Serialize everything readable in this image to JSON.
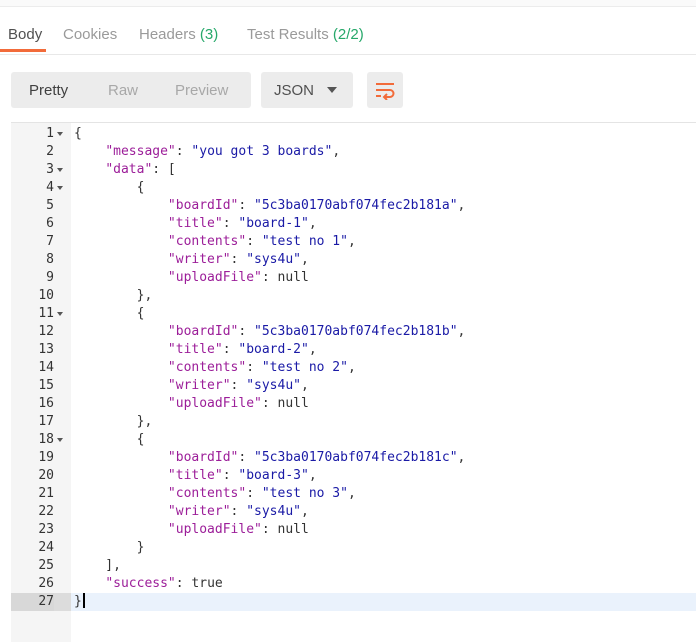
{
  "tabs": [
    {
      "label": "Body",
      "count": ""
    },
    {
      "label": "Cookies",
      "count": ""
    },
    {
      "label": "Headers",
      "count": "(3)"
    },
    {
      "label": "Test Results",
      "count": "(2/2)"
    }
  ],
  "view_modes": {
    "pretty": "Pretty",
    "raw": "Raw",
    "preview": "Preview"
  },
  "format_select": {
    "selected": "JSON"
  },
  "editor": {
    "active_line": 27,
    "lines": [
      {
        "n": "1",
        "fold": true,
        "tokens": [
          {
            "c": "p",
            "t": "{"
          }
        ]
      },
      {
        "n": "2",
        "fold": false,
        "tokens": [
          {
            "c": "p",
            "t": "    "
          },
          {
            "c": "k",
            "t": "\"message\""
          },
          {
            "c": "p",
            "t": ": "
          },
          {
            "c": "s",
            "t": "\"you got 3 boards\""
          },
          {
            "c": "p",
            "t": ","
          }
        ]
      },
      {
        "n": "3",
        "fold": true,
        "tokens": [
          {
            "c": "p",
            "t": "    "
          },
          {
            "c": "k",
            "t": "\"data\""
          },
          {
            "c": "p",
            "t": ": ["
          }
        ]
      },
      {
        "n": "4",
        "fold": true,
        "tokens": [
          {
            "c": "p",
            "t": "        {"
          }
        ]
      },
      {
        "n": "5",
        "fold": false,
        "tokens": [
          {
            "c": "p",
            "t": "            "
          },
          {
            "c": "k",
            "t": "\"boardId\""
          },
          {
            "c": "p",
            "t": ": "
          },
          {
            "c": "s",
            "t": "\"5c3ba0170abf074fec2b181a\""
          },
          {
            "c": "p",
            "t": ","
          }
        ]
      },
      {
        "n": "6",
        "fold": false,
        "tokens": [
          {
            "c": "p",
            "t": "            "
          },
          {
            "c": "k",
            "t": "\"title\""
          },
          {
            "c": "p",
            "t": ": "
          },
          {
            "c": "s",
            "t": "\"board-1\""
          },
          {
            "c": "p",
            "t": ","
          }
        ]
      },
      {
        "n": "7",
        "fold": false,
        "tokens": [
          {
            "c": "p",
            "t": "            "
          },
          {
            "c": "k",
            "t": "\"contents\""
          },
          {
            "c": "p",
            "t": ": "
          },
          {
            "c": "s",
            "t": "\"test no 1\""
          },
          {
            "c": "p",
            "t": ","
          }
        ]
      },
      {
        "n": "8",
        "fold": false,
        "tokens": [
          {
            "c": "p",
            "t": "            "
          },
          {
            "c": "k",
            "t": "\"writer\""
          },
          {
            "c": "p",
            "t": ": "
          },
          {
            "c": "s",
            "t": "\"sys4u\""
          },
          {
            "c": "p",
            "t": ","
          }
        ]
      },
      {
        "n": "9",
        "fold": false,
        "tokens": [
          {
            "c": "p",
            "t": "            "
          },
          {
            "c": "k",
            "t": "\"uploadFile\""
          },
          {
            "c": "p",
            "t": ": null"
          }
        ]
      },
      {
        "n": "10",
        "fold": false,
        "tokens": [
          {
            "c": "p",
            "t": "        },"
          }
        ]
      },
      {
        "n": "11",
        "fold": true,
        "tokens": [
          {
            "c": "p",
            "t": "        {"
          }
        ]
      },
      {
        "n": "12",
        "fold": false,
        "tokens": [
          {
            "c": "p",
            "t": "            "
          },
          {
            "c": "k",
            "t": "\"boardId\""
          },
          {
            "c": "p",
            "t": ": "
          },
          {
            "c": "s",
            "t": "\"5c3ba0170abf074fec2b181b\""
          },
          {
            "c": "p",
            "t": ","
          }
        ]
      },
      {
        "n": "13",
        "fold": false,
        "tokens": [
          {
            "c": "p",
            "t": "            "
          },
          {
            "c": "k",
            "t": "\"title\""
          },
          {
            "c": "p",
            "t": ": "
          },
          {
            "c": "s",
            "t": "\"board-2\""
          },
          {
            "c": "p",
            "t": ","
          }
        ]
      },
      {
        "n": "14",
        "fold": false,
        "tokens": [
          {
            "c": "p",
            "t": "            "
          },
          {
            "c": "k",
            "t": "\"contents\""
          },
          {
            "c": "p",
            "t": ": "
          },
          {
            "c": "s",
            "t": "\"test no 2\""
          },
          {
            "c": "p",
            "t": ","
          }
        ]
      },
      {
        "n": "15",
        "fold": false,
        "tokens": [
          {
            "c": "p",
            "t": "            "
          },
          {
            "c": "k",
            "t": "\"writer\""
          },
          {
            "c": "p",
            "t": ": "
          },
          {
            "c": "s",
            "t": "\"sys4u\""
          },
          {
            "c": "p",
            "t": ","
          }
        ]
      },
      {
        "n": "16",
        "fold": false,
        "tokens": [
          {
            "c": "p",
            "t": "            "
          },
          {
            "c": "k",
            "t": "\"uploadFile\""
          },
          {
            "c": "p",
            "t": ": null"
          }
        ]
      },
      {
        "n": "17",
        "fold": false,
        "tokens": [
          {
            "c": "p",
            "t": "        },"
          }
        ]
      },
      {
        "n": "18",
        "fold": true,
        "tokens": [
          {
            "c": "p",
            "t": "        {"
          }
        ]
      },
      {
        "n": "19",
        "fold": false,
        "tokens": [
          {
            "c": "p",
            "t": "            "
          },
          {
            "c": "k",
            "t": "\"boardId\""
          },
          {
            "c": "p",
            "t": ": "
          },
          {
            "c": "s",
            "t": "\"5c3ba0170abf074fec2b181c\""
          },
          {
            "c": "p",
            "t": ","
          }
        ]
      },
      {
        "n": "20",
        "fold": false,
        "tokens": [
          {
            "c": "p",
            "t": "            "
          },
          {
            "c": "k",
            "t": "\"title\""
          },
          {
            "c": "p",
            "t": ": "
          },
          {
            "c": "s",
            "t": "\"board-3\""
          },
          {
            "c": "p",
            "t": ","
          }
        ]
      },
      {
        "n": "21",
        "fold": false,
        "tokens": [
          {
            "c": "p",
            "t": "            "
          },
          {
            "c": "k",
            "t": "\"contents\""
          },
          {
            "c": "p",
            "t": ": "
          },
          {
            "c": "s",
            "t": "\"test no 3\""
          },
          {
            "c": "p",
            "t": ","
          }
        ]
      },
      {
        "n": "22",
        "fold": false,
        "tokens": [
          {
            "c": "p",
            "t": "            "
          },
          {
            "c": "k",
            "t": "\"writer\""
          },
          {
            "c": "p",
            "t": ": "
          },
          {
            "c": "s",
            "t": "\"sys4u\""
          },
          {
            "c": "p",
            "t": ","
          }
        ]
      },
      {
        "n": "23",
        "fold": false,
        "tokens": [
          {
            "c": "p",
            "t": "            "
          },
          {
            "c": "k",
            "t": "\"uploadFile\""
          },
          {
            "c": "p",
            "t": ": null"
          }
        ]
      },
      {
        "n": "24",
        "fold": false,
        "tokens": [
          {
            "c": "p",
            "t": "        }"
          }
        ]
      },
      {
        "n": "25",
        "fold": false,
        "tokens": [
          {
            "c": "p",
            "t": "    ],"
          }
        ]
      },
      {
        "n": "26",
        "fold": false,
        "tokens": [
          {
            "c": "p",
            "t": "    "
          },
          {
            "c": "k",
            "t": "\"success\""
          },
          {
            "c": "p",
            "t": ": true"
          }
        ]
      },
      {
        "n": "27",
        "fold": false,
        "tokens": [
          {
            "c": "p",
            "t": "}"
          }
        ]
      }
    ]
  },
  "colors": {
    "accent": "#f26b3a",
    "count": "#26a86a",
    "key": "#9c1e99",
    "string": "#1a1aa6"
  },
  "icons": {
    "wrap": "wrap-lines-icon",
    "fold": "fold-arrow-icon",
    "dropdown": "chevron-down-icon"
  }
}
